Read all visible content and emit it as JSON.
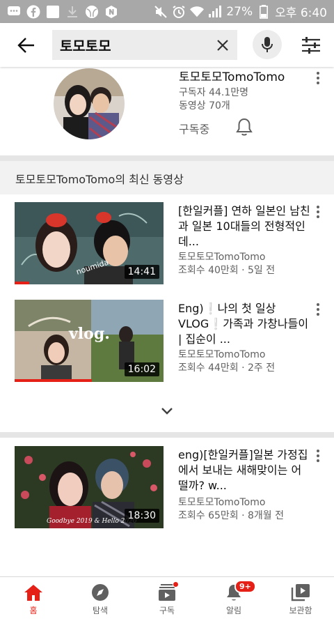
{
  "status_bar": {
    "battery_percent": "27%",
    "time": "오후 6:40"
  },
  "search": {
    "query": "토모토모"
  },
  "channel": {
    "name": "토모토모TomoTomo",
    "subscribers": "구독자 44.1만명",
    "video_count": "동영상 70개",
    "subscribed_label": "구독중"
  },
  "section": {
    "title": "토모토모TomoTomo의 최신 동영상"
  },
  "videos": [
    {
      "title": "[한일커플] 연하 일본인 남친과 일본 10대들의 전형적인 데...",
      "channel": "토모토모TomoTomo",
      "meta": "조회수 40만회 · 5일 전",
      "duration": "14:41",
      "watched": 0.1
    },
    {
      "title": "Eng)❕나의 첫 일상 VLOG❕가족과 가창나들이 | 집순이 ...",
      "channel": "토모토모TomoTomo",
      "meta": "조회수 44만회 · 2주 전",
      "duration": "16:02",
      "watched": 0.52
    },
    {
      "title": "eng)[한일커플]일본 가정집에서 보내는 새해맞이는 어떨까? w...",
      "channel": "토모토모TomoTomo",
      "meta": "조회수 65만회 · 8개월 전",
      "duration": "18:30",
      "watched": 0
    }
  ],
  "thumb_texts": {
    "v2": "vlog.",
    "v3": "Goodbye 2019 & Hello 2020"
  },
  "nav": {
    "home": "홈",
    "explore": "탐색",
    "subscriptions": "구독",
    "notifications": "알림",
    "notifications_badge": "9+",
    "library": "보관함"
  },
  "colors": {
    "accent": "#e52117",
    "secondary_text": "#606060"
  }
}
